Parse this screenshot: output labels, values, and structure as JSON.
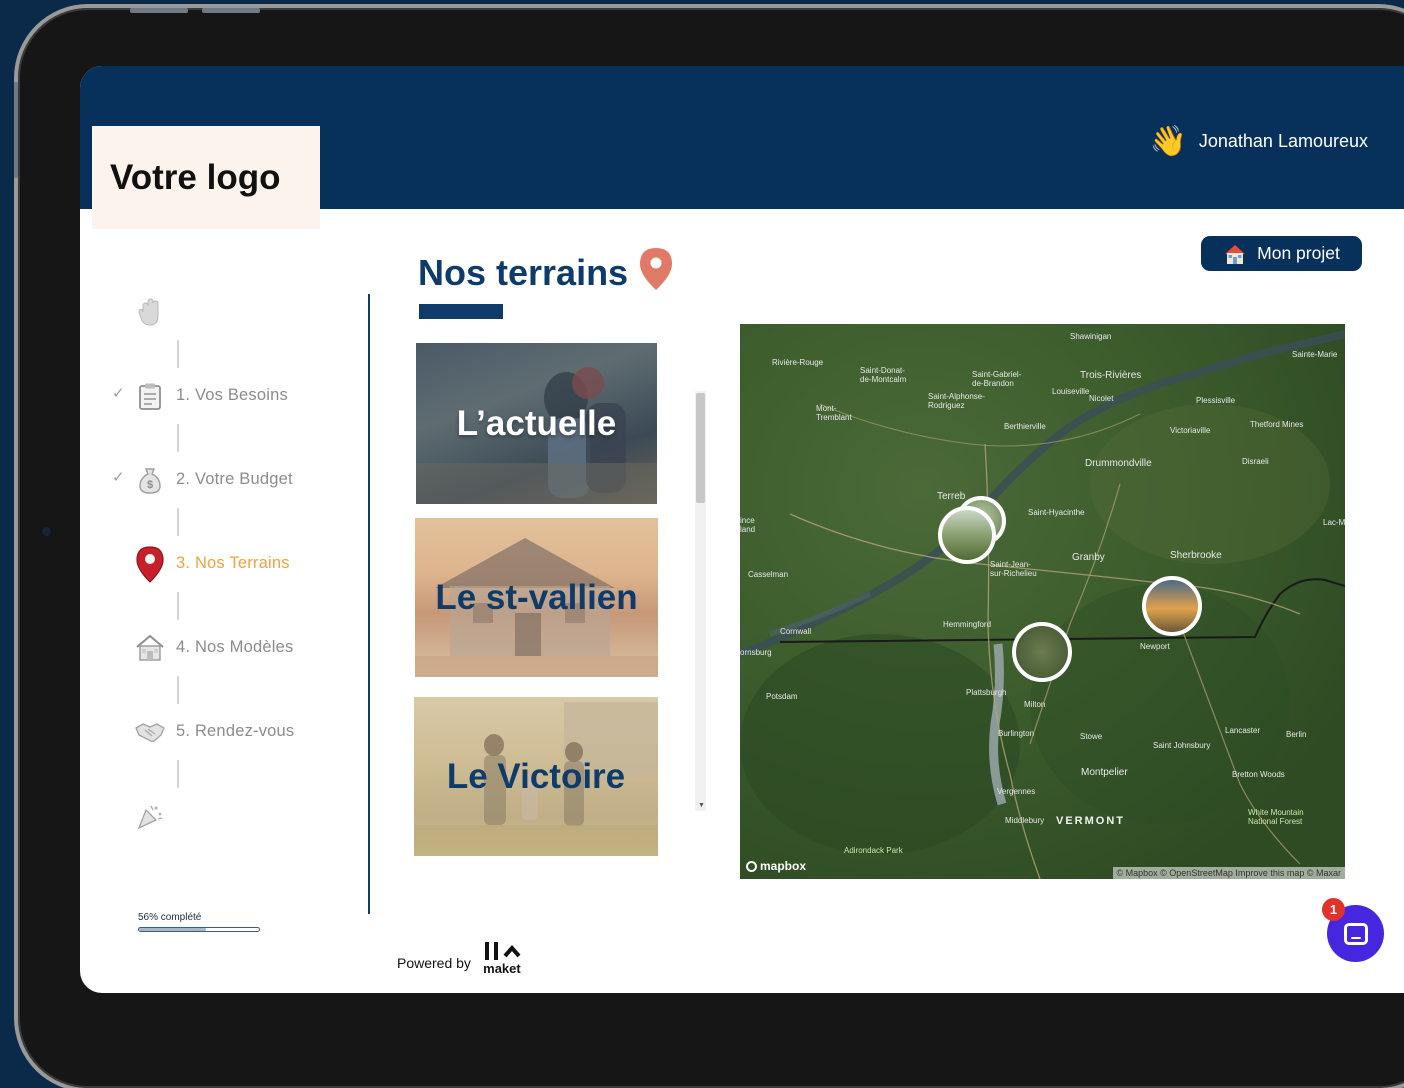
{
  "header": {
    "logo_text": "Votre logo",
    "user_name": "Jonathan Lamoureux",
    "user_icon": "waving-hand-icon"
  },
  "stepper": {
    "steps": [
      {
        "label": "",
        "icon": "waving-hand-icon",
        "checked": false
      },
      {
        "label": "1. Vos Besoins",
        "icon": "clipboard-icon",
        "checked": true
      },
      {
        "label": "2. Votre Budget",
        "icon": "money-bag-icon",
        "checked": true
      },
      {
        "label": "3. Nos Terrains",
        "icon": "map-pin-icon",
        "checked": false,
        "active": true
      },
      {
        "label": "4. Nos Modèles",
        "icon": "house-icon",
        "checked": false
      },
      {
        "label": "5. Rendez-vous",
        "icon": "handshake-icon",
        "checked": false
      },
      {
        "label": "",
        "icon": "party-popper-icon",
        "checked": false
      }
    ],
    "active_color": "#f0a23e",
    "progress": {
      "label": "56% complété",
      "percent": 56
    }
  },
  "main": {
    "title": "Nos terrains",
    "project_button": "Mon projet",
    "terrains": [
      {
        "name": "L’actuelle"
      },
      {
        "name": "Le st-vallien"
      },
      {
        "name": "Le Victoire"
      }
    ]
  },
  "map": {
    "labels": {
      "shawinigan": "Shawinigan",
      "riviere_rouge": "Rivière-Rouge",
      "saint_donat": "Saint-Donat-\nde-Montcalm",
      "saint_gabriel": "Saint-Gabriel-\nde-Brandon",
      "trois_rivieres": "Trois-Rivières",
      "sainte_marie": "Sainte-Marie",
      "louiseville": "Louiseville",
      "nicolet": "Nicolet",
      "saint_alphonse": "Saint-Alphonse-\nRodriguez",
      "mont_tremblant": "Mont-\nTremblant",
      "plessisville": "Plessisville",
      "berthierville": "Berthierville",
      "victoriaville": "Victoriaville",
      "thetford": "Thetford Mines",
      "drummondville": "Drummondville",
      "disraeli": "Disraeli",
      "terrebonne": "Terreb",
      "saint_hyacinthe": "Saint-Hyacinthe",
      "lac_megantic": "Lac-Még",
      "lachute": "ince\nland",
      "granby": "Granby",
      "sherbrooke": "Sherbrooke",
      "casselman": "Casselman",
      "st_jean": "Saint-Jean-\nsur-Richelieu",
      "hemmingford": "Hemmingford",
      "cornwall": "Cornwall",
      "newport": "Newport",
      "ornsburg": "ornsburg",
      "potsdam": "Potsdam",
      "plattsburgh": "Plattsburgh",
      "milton": "Milton",
      "lancaster": "Lancaster",
      "berlin": "Berlin",
      "burlington": "Burlington",
      "stowe": "Stowe",
      "saint_johnsbury": "Saint Johnsbury",
      "montpelier": "Montpelier",
      "bretton": "Bretton Woods",
      "vergennes": "Vergennes",
      "middlebury": "Middlebury",
      "vermont": "VERMONT",
      "white_mountain": "White Mountain\nNational Forest",
      "adirondack": "Adirondack Park"
    },
    "logo": "mapbox",
    "attribution": "© Mapbox © OpenStreetMap  Improve this map © Maxar"
  },
  "chat": {
    "badge_count": "1"
  },
  "footer": {
    "powered_by": "Powered by",
    "brand_mark": "II^",
    "brand_name": "maket"
  }
}
